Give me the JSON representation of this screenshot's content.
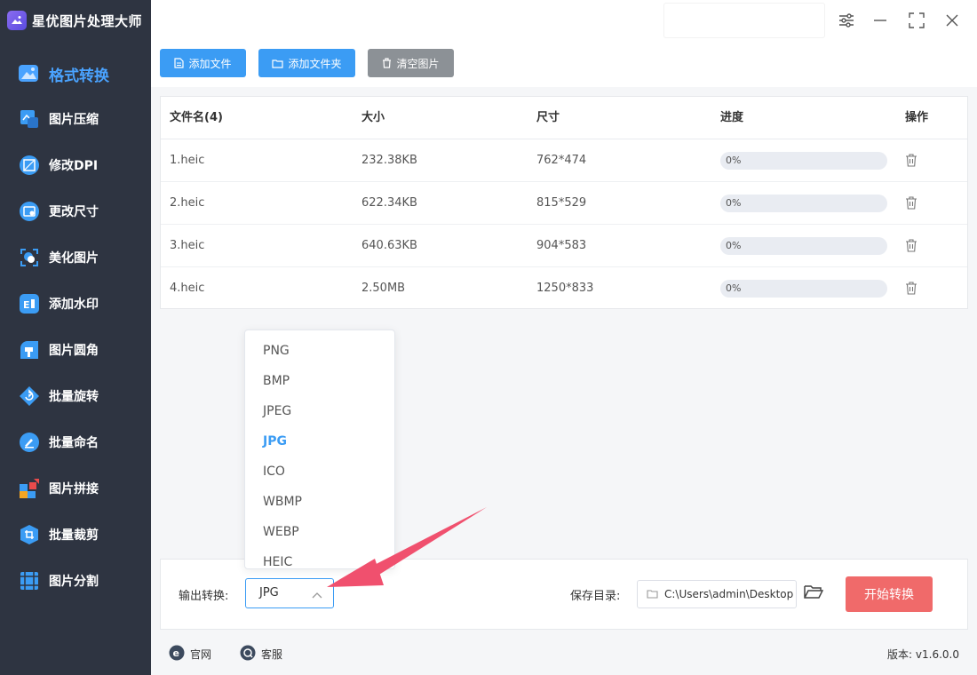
{
  "app": {
    "title": "星优图片处理大师"
  },
  "sidebar": {
    "items": [
      {
        "label": "格式转换",
        "icon": "image-icon",
        "active": true
      },
      {
        "label": "图片压缩",
        "icon": "compress-icon"
      },
      {
        "label": "修改DPI",
        "icon": "dpi-icon"
      },
      {
        "label": "更改尺寸",
        "icon": "resize-icon"
      },
      {
        "label": "美化图片",
        "icon": "beautify-icon"
      },
      {
        "label": "添加水印",
        "icon": "watermark-icon"
      },
      {
        "label": "图片圆角",
        "icon": "round-corner-icon"
      },
      {
        "label": "批量旋转",
        "icon": "rotate-icon"
      },
      {
        "label": "批量命名",
        "icon": "rename-icon"
      },
      {
        "label": "图片拼接",
        "icon": "puzzle-icon"
      },
      {
        "label": "批量裁剪",
        "icon": "crop-icon"
      },
      {
        "label": "图片分割",
        "icon": "split-icon"
      }
    ]
  },
  "toolbar": {
    "add_file": "添加文件",
    "add_folder": "添加文件夹",
    "clear": "清空图片"
  },
  "table": {
    "headers": {
      "name": "文件名(4)",
      "size": "大小",
      "dims": "尺寸",
      "progress": "进度",
      "action": "操作"
    },
    "rows": [
      {
        "name": "1.heic",
        "size": "232.38KB",
        "dims": "762*474",
        "progress": "0%"
      },
      {
        "name": "2.heic",
        "size": "622.34KB",
        "dims": "815*529",
        "progress": "0%"
      },
      {
        "name": "3.heic",
        "size": "640.63KB",
        "dims": "904*583",
        "progress": "0%"
      },
      {
        "name": "4.heic",
        "size": "2.50MB",
        "dims": "1250*833",
        "progress": "0%"
      }
    ]
  },
  "dropdown": {
    "options": [
      "PNG",
      "BMP",
      "JPEG",
      "JPG",
      "ICO",
      "WBMP",
      "WEBP",
      "HEIC"
    ],
    "selected": "JPG"
  },
  "bottom": {
    "output_label": "输出转换:",
    "output_value": "JPG",
    "save_label": "保存目录:",
    "save_path": "C:\\Users\\admin\\Desktop",
    "start": "开始转换"
  },
  "footer": {
    "website": "官网",
    "service": "客服",
    "version": "版本: v1.6.0.0"
  },
  "colors": {
    "accent": "#3b9cf4",
    "start_button": "#f06a6a",
    "sidebar": "#2e3441",
    "annotation_arrow": "#f0506e"
  }
}
